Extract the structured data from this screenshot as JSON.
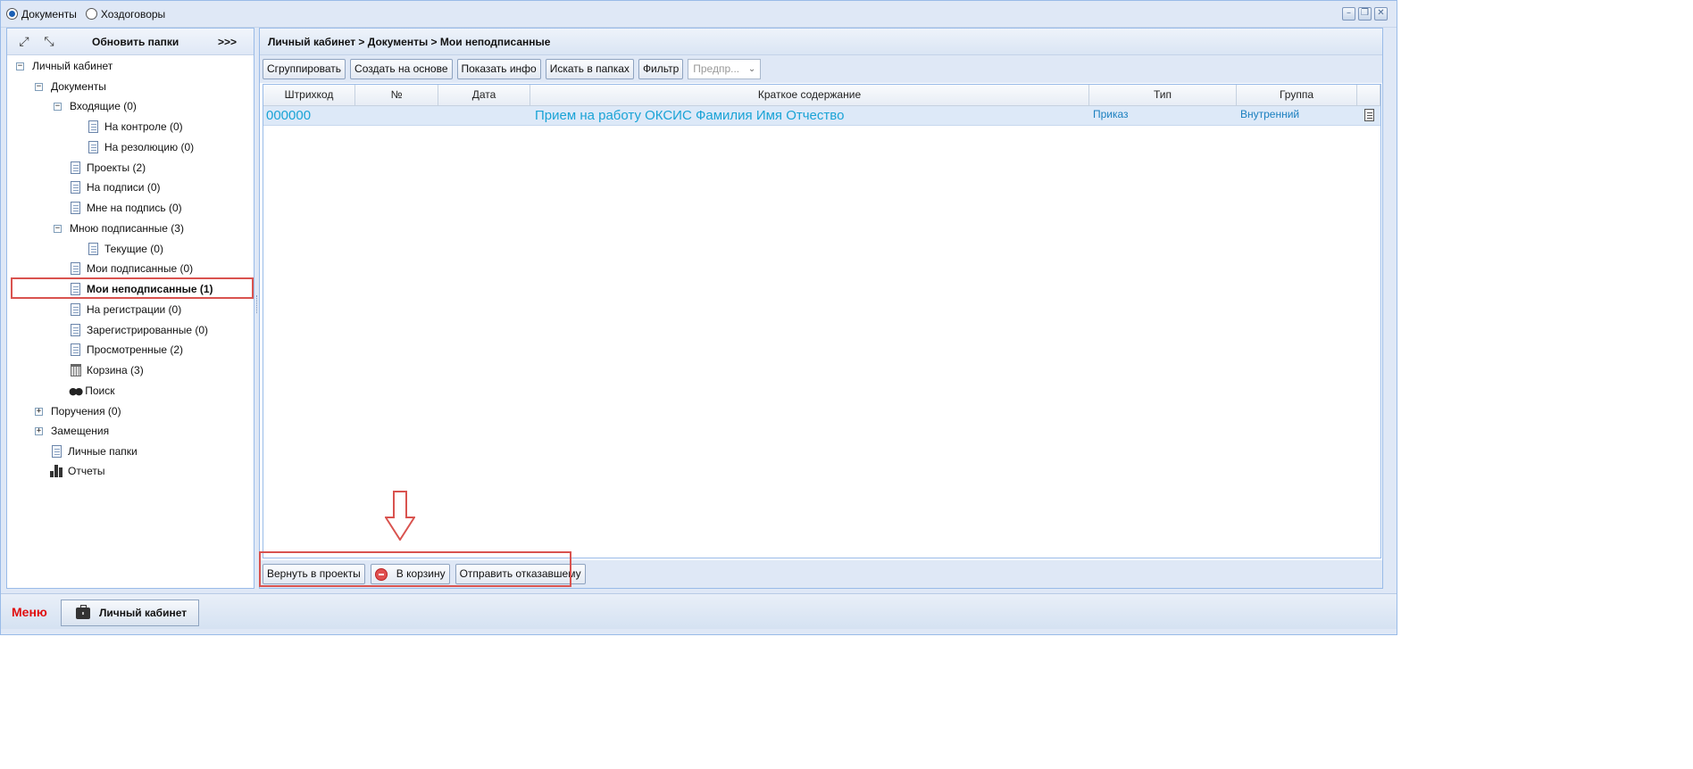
{
  "top": {
    "radios": [
      {
        "label": "Документы",
        "checked": true
      },
      {
        "label": "Хоздоговоры",
        "checked": false
      }
    ],
    "window_buttons": [
      "minimize-icon",
      "restore-icon",
      "close-icon"
    ]
  },
  "left": {
    "toolbar": {
      "refresh_label": "Обновить папки",
      "more_label": ">>>"
    },
    "tree": [
      {
        "label": "Личный кабинет",
        "toggle": "-"
      },
      {
        "label": "Документы",
        "toggle": "-"
      },
      {
        "label": "Входящие (0)",
        "toggle": "-"
      },
      {
        "label": "На контроле (0)",
        "icon": "doc"
      },
      {
        "label": "На резолюцию (0)",
        "icon": "doc"
      },
      {
        "label": "Проекты (2)",
        "icon": "doc"
      },
      {
        "label": "На подписи (0)",
        "icon": "doc"
      },
      {
        "label": "Мне на подпись (0)",
        "icon": "doc"
      },
      {
        "label": "Мною подписанные (3)",
        "toggle": "-"
      },
      {
        "label": "Текущие (0)",
        "icon": "doc"
      },
      {
        "label": "Мои подписанные (0)",
        "icon": "doc"
      },
      {
        "label": "Мои неподписанные (1)",
        "icon": "doc",
        "selected": true
      },
      {
        "label": "На регистрации (0)",
        "icon": "doc"
      },
      {
        "label": "Зарегистрированные (0)",
        "icon": "doc"
      },
      {
        "label": "Просмотренные (2)",
        "icon": "doc"
      },
      {
        "label": "Корзина (3)",
        "icon": "trash"
      },
      {
        "label": "Поиск",
        "icon": "binoculars"
      },
      {
        "label": "Поручения (0)",
        "toggle": "+"
      },
      {
        "label": "Замещения",
        "toggle": "+"
      },
      {
        "label": "Личные папки",
        "icon": "doc"
      },
      {
        "label": "Отчеты",
        "icon": "bars"
      }
    ]
  },
  "right": {
    "breadcrumb": "Личный кабинет > Документы > Мои неподписанные",
    "toolbar": {
      "group": "Сгруппировать",
      "create_based": "Создать на основе",
      "show_info": "Показать инфо",
      "search_folders": "Искать в папках",
      "filter": "Фильтр",
      "select_placeholder": "Предпр..."
    },
    "columns": [
      "Штрихкод",
      "№",
      "Дата",
      "Краткое содержание",
      "Тип",
      "Группа"
    ],
    "rows": [
      {
        "barcode": "000000",
        "number": "",
        "date": "",
        "summary": "Прием на работу ОКСИС Фамилия Имя Отчество",
        "type": "Приказ",
        "group": "Внутренний"
      }
    ],
    "bottom": {
      "back_to_projects": "Вернуть в проекты",
      "to_trash": "В корзину",
      "send_refused": "Отправить отказавшему"
    }
  },
  "status": {
    "menu_label": "Меню",
    "cabinet_label": "Личный кабинет"
  }
}
